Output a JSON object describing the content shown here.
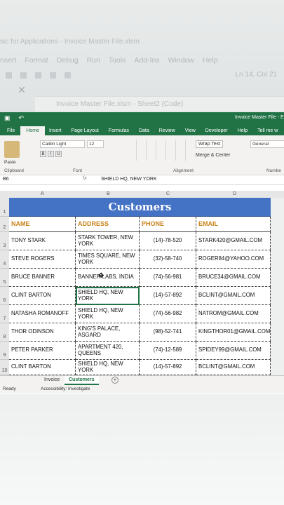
{
  "vba": {
    "title": "sic for Applications - Invoice Master File.xlsm",
    "menu": [
      "nsert",
      "Format",
      "Debug",
      "Run",
      "Tools",
      "Add-Ins",
      "Window",
      "Help"
    ],
    "position": "Ln 14, Col 21",
    "code_window_title": "Invoice Master File.xlsm - Sheet2 (Code)"
  },
  "excel": {
    "file_title": "Invoice Master File - E",
    "ribbon_tabs": [
      "File",
      "Home",
      "Insert",
      "Page Layout",
      "Formulas",
      "Data",
      "Review",
      "View",
      "Developer",
      "Help",
      "Tell me w"
    ],
    "active_tab": "Home",
    "font_name": "Calibri Light",
    "font_size": "12",
    "wrap_text": "Wrap Text",
    "merge_center": "Merge & Center",
    "number_format": "General",
    "paste_label": "Paste",
    "groups": {
      "clipboard": "Clipboard",
      "font": "Font",
      "alignment": "Alignment",
      "number": "Numbe"
    },
    "name_box": "B6",
    "fx": "fx",
    "formula_value": "SHIELD HQ, NEW YORK",
    "columns": [
      "A",
      "B",
      "C",
      "D"
    ],
    "rows": [
      "1",
      "2",
      "3",
      "4",
      "5",
      "6",
      "7",
      "8",
      "9",
      "10"
    ],
    "sheet_tabs": [
      "Invoice",
      "Customers"
    ],
    "active_sheet": "Customers",
    "status": {
      "ready": "Ready",
      "accessibility": "Accessibility: Investigate"
    }
  },
  "table": {
    "title": "Customers",
    "headers": [
      "NAME",
      "ADDRESS",
      "PHONE",
      "EMAIL"
    ],
    "rows": [
      [
        "TONY STARK",
        "STARK TOWER, NEW YORK",
        "(14)-78-520",
        "STARK420@GMAIL.COM"
      ],
      [
        "STEVE ROGERS",
        "TIMES SQUARE, NEW YORK",
        "(32)-58-740",
        "ROGER84@YAHOO.COM"
      ],
      [
        "BRUCE BANNER",
        "BANNER LABS, INDIA",
        "(74)-56-981",
        "BRUCE34@GMAIL.COM"
      ],
      [
        "CLINT BARTON",
        "SHIELD HQ, NEW YORK",
        "(14)-57-892",
        "BCLINT@GMAIL.COM"
      ],
      [
        "NATASHA ROMANOFF",
        "SHIELD HQ, NEW YORK",
        "(74)-56-982",
        "NATROM@GMAIL.COM"
      ],
      [
        "THOR ODINSON",
        "KING'S PALACE, ASGARD",
        "(98)-52-741",
        "KINGTHOR01@GMAIL.COM"
      ],
      [
        "PETER PARKER",
        "APARTMENT 420, QUEENS",
        "(74)-12-589",
        "SPIDEY99@GMAIL.COM"
      ],
      [
        "CLINT BARTON",
        "SHIELD HQ, NEW YORK",
        "(14)-57-892",
        "BCLINT@GMAIL.COM"
      ]
    ]
  }
}
